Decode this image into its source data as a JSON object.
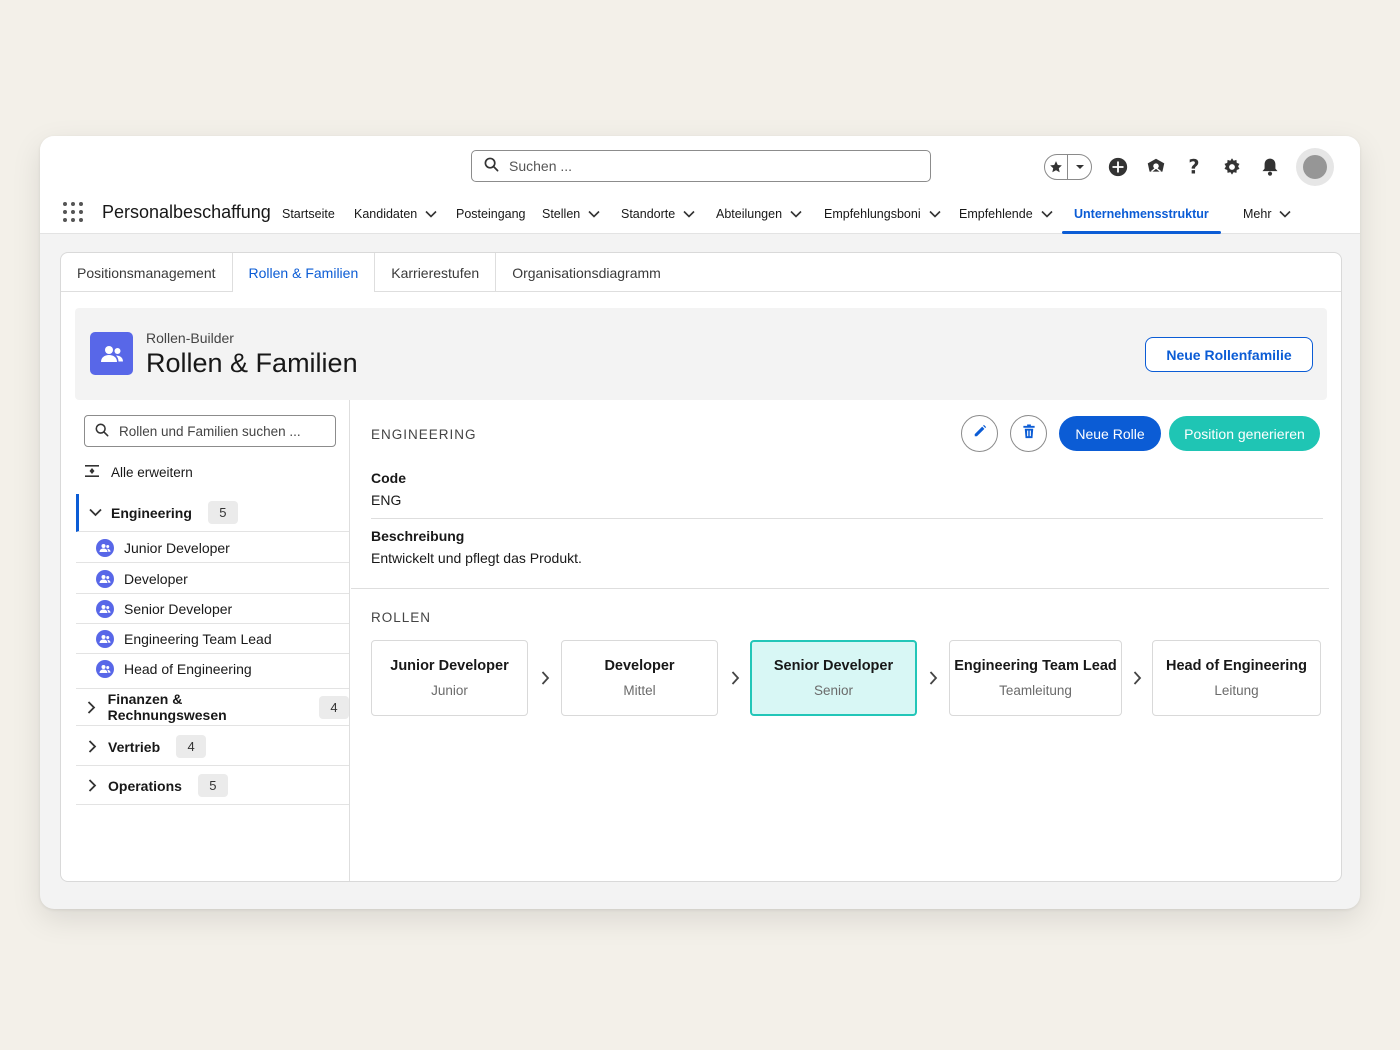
{
  "header": {
    "search_placeholder": "Suchen ...",
    "icons": [
      "star-icon",
      "add-icon",
      "setup-icon",
      "help-icon",
      "gear-icon",
      "bell-icon"
    ]
  },
  "nav": {
    "app_name": "Personalbeschaffung",
    "items": [
      {
        "label": "Startseite",
        "dropdown": false
      },
      {
        "label": "Kandidaten",
        "dropdown": true
      },
      {
        "label": "Posteingang",
        "dropdown": false
      },
      {
        "label": "Stellen",
        "dropdown": true
      },
      {
        "label": "Standorte",
        "dropdown": true
      },
      {
        "label": "Abteilungen",
        "dropdown": true
      },
      {
        "label": "Empfehlungsboni",
        "dropdown": true
      },
      {
        "label": "Empfehlende",
        "dropdown": true
      },
      {
        "label": "Unternehmensstruktur",
        "dropdown": false,
        "active": true
      },
      {
        "label": "Mehr",
        "dropdown": true
      }
    ]
  },
  "tabs": [
    "Positionsmanagement",
    "Rollen & Familien",
    "Karrierestufen",
    "Organisationsdiagramm"
  ],
  "page": {
    "eyebrow": "Rollen-Builder",
    "title": "Rollen & Familien",
    "new_family_button": "Neue Rollenfamilie"
  },
  "left": {
    "search_placeholder": "Rollen und Familien suchen ...",
    "expand_all": "Alle erweitern",
    "families": [
      {
        "name": "Engineering",
        "count": "5",
        "expanded": true,
        "roles": [
          "Junior Developer",
          "Developer",
          "Senior Developer",
          "Engineering Team Lead",
          "Head of Engineering"
        ]
      },
      {
        "name": "Finanzen & Rechnungswesen",
        "count": "4",
        "expanded": false
      },
      {
        "name": "Vertrieb",
        "count": "4",
        "expanded": false
      },
      {
        "name": "Operations",
        "count": "5",
        "expanded": false
      }
    ]
  },
  "detail": {
    "section_title": "ENGINEERING",
    "new_role_button": "Neue Rolle",
    "generate_button": "Position generieren",
    "code_label": "Code",
    "code_value": "ENG",
    "description_label": "Beschreibung",
    "description_value": "Entwickelt und pflegt das Produkt.",
    "roles_title": "ROLLEN",
    "ladder": [
      {
        "name": "Junior Developer",
        "level": "Junior"
      },
      {
        "name": "Developer",
        "level": "Mittel"
      },
      {
        "name": "Senior Developer",
        "level": "Senior",
        "selected": true
      },
      {
        "name": "Engineering Team Lead",
        "level": "Teamleitung"
      },
      {
        "name": "Head of Engineering",
        "level": "Leitung"
      }
    ]
  },
  "colors": {
    "brand_blue": "#0b5cd5",
    "teal": "#1fc5b4",
    "selected_bg": "#d8f7f5",
    "icon_purple": "#5867e8"
  }
}
